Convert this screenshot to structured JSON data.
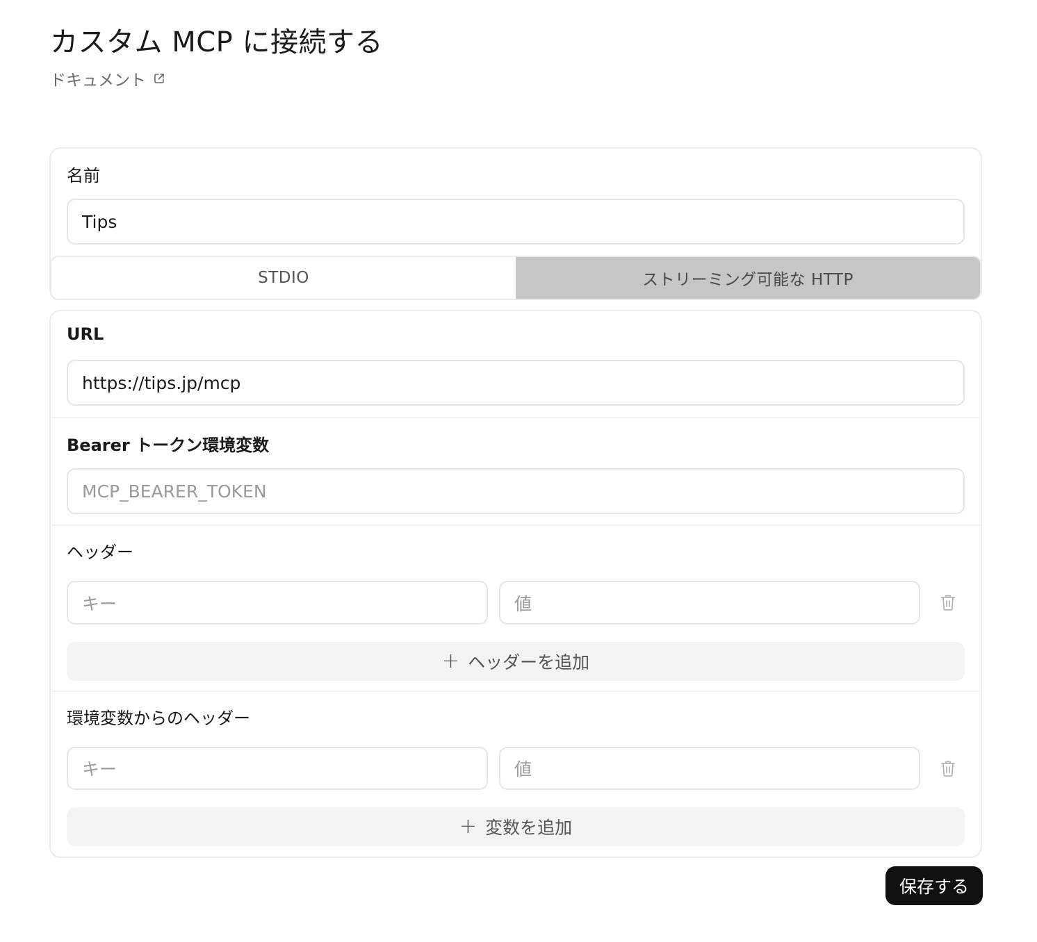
{
  "page": {
    "title": "カスタム MCP に接続する",
    "doc_link_label": "ドキュメント",
    "doc_link_icon": "external-link-icon"
  },
  "name_section": {
    "label": "名前",
    "value": "Tips"
  },
  "transport_tabs": [
    {
      "label": "STDIO",
      "selected": false
    },
    {
      "label": "ストリーミング可能な HTTP",
      "selected": true
    }
  ],
  "url_section": {
    "label": "URL",
    "value": "https://tips.jp/mcp"
  },
  "bearer_section": {
    "label": "Bearer トークン環境変数",
    "placeholder": "MCP_BEARER_TOKEN"
  },
  "headers_section": {
    "label": "ヘッダー",
    "key_placeholder": "キー",
    "value_placeholder": "値",
    "delete_icon": "trash-icon",
    "add_label": "ヘッダーを追加"
  },
  "env_headers_section": {
    "label": "環境変数からのヘッダー",
    "key_placeholder": "キー",
    "value_placeholder": "値",
    "delete_icon": "trash-icon",
    "add_label": "変数を追加"
  },
  "save_label": "保存する",
  "colors": {
    "primary_button": "#111111",
    "active_tab": "#c6c6c6",
    "add_button_bg": "#f3f3f3",
    "border": "#e6e6e6"
  }
}
